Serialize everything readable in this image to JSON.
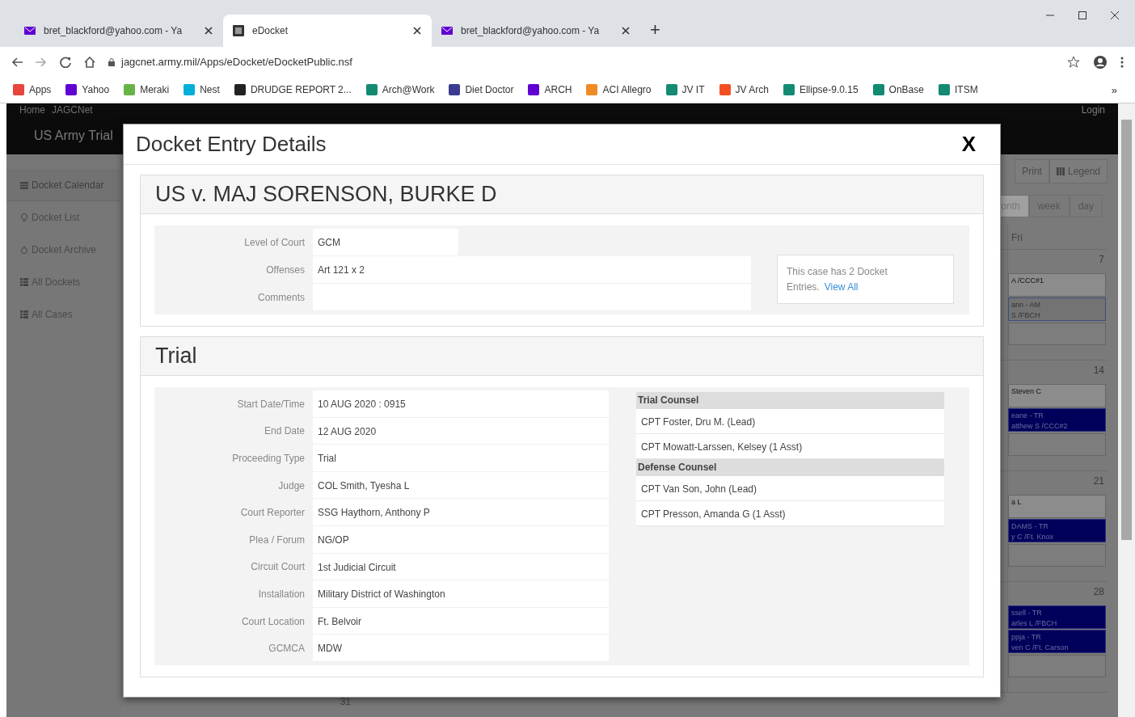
{
  "browser": {
    "tabs": [
      {
        "title": "bret_blackford@yahoo.com - Ya",
        "kind": "mail",
        "selected": false
      },
      {
        "title": "eDocket",
        "kind": "doc",
        "selected": true
      },
      {
        "title": "bret_blackford@yahoo.com - Ya",
        "kind": "mail",
        "selected": false
      }
    ],
    "new_tab": "+",
    "address": "jagcnet.army.mil/Apps/eDocket/eDocketPublic.nsf",
    "bookmarks": [
      {
        "label": "Apps",
        "color": "#e8453c"
      },
      {
        "label": "Yahoo",
        "color": "#6001d2"
      },
      {
        "label": "Meraki",
        "color": "#67b346"
      },
      {
        "label": "Nest",
        "color": "#00afd8"
      },
      {
        "label": "DRUDGE REPORT 2...",
        "color": "#222222"
      },
      {
        "label": "Arch@Work",
        "color": "#138a72"
      },
      {
        "label": "Diet Doctor",
        "color": "#3b3b8f"
      },
      {
        "label": "ARCH",
        "color": "#6001d2"
      },
      {
        "label": "ACI Allegro",
        "color": "#f08a24"
      },
      {
        "label": "JV IT",
        "color": "#138a72"
      },
      {
        "label": "JV Arch",
        "color": "#f25022"
      },
      {
        "label": "Ellipse-9.0.15",
        "color": "#138a72"
      },
      {
        "label": "OnBase",
        "color": "#138a72"
      },
      {
        "label": "ITSM",
        "color": "#138a72"
      }
    ],
    "more": "»"
  },
  "page": {
    "nav_links": [
      "Home",
      "JAGCNet"
    ],
    "login": "Login",
    "site_title": "US Army Trial",
    "sidebar": [
      {
        "label": "Docket Calendar",
        "kind": "calendar",
        "selected": true
      },
      {
        "label": "Docket List",
        "kind": "bulb",
        "selected": false
      },
      {
        "label": "Docket Archive",
        "kind": "archive",
        "selected": false
      },
      {
        "label": "All Dockets",
        "kind": "grid",
        "selected": false
      },
      {
        "label": "All Cases",
        "kind": "grid",
        "selected": false
      }
    ],
    "toolbar": [
      "Print",
      "Legend"
    ],
    "views": [
      {
        "label": "onth",
        "selected": true
      },
      {
        "label": "week",
        "selected": false
      },
      {
        "label": "day",
        "selected": false
      }
    ],
    "weekday": "Fri",
    "weeks": [
      {
        "day": "7",
        "events": [
          {
            "kind": "gray",
            "lines": [
              "A /CCC#1"
            ]
          },
          {
            "kind": "outline",
            "lines": [
              "ann - AM",
              "S /FBCH"
            ]
          }
        ]
      },
      {
        "day": "14",
        "events": [
          {
            "kind": "gray",
            "lines": [
              "Steven C"
            ]
          },
          {
            "kind": "navy",
            "lines": [
              "eane - TR",
              "atthew S /CCC#2"
            ]
          }
        ]
      },
      {
        "day": "21",
        "events": [
          {
            "kind": "gray",
            "lines": [
              "a L"
            ]
          },
          {
            "kind": "navy",
            "lines": [
              "DAMS - TR",
              "y C /Ft. Knox"
            ]
          }
        ]
      },
      {
        "day": "28",
        "events": [
          {
            "kind": "navy",
            "lines": [
              "ssell - TR",
              "arles L /FBCH"
            ]
          },
          {
            "kind": "navy",
            "lines": [
              "ppja - TR",
              "ven C /Ft. Carson"
            ]
          }
        ]
      }
    ],
    "last_row_day": "31"
  },
  "modal": {
    "title": "Docket Entry Details",
    "close": "X",
    "case": {
      "heading": "US v. MAJ SORENSON, BURKE D",
      "fields": [
        {
          "label": "Level of Court",
          "value": "GCM",
          "kind": "short"
        },
        {
          "label": "Offenses",
          "value": "Art 121 x 2",
          "kind": "wide"
        },
        {
          "label": "Comments",
          "kind": "wide"
        }
      ],
      "entries_note": "This case has 2 Docket Entries.",
      "view_all": "View All"
    },
    "trial": {
      "heading": "Trial",
      "fields": [
        {
          "label": "Start Date/Time",
          "value": "10 AUG 2020 : 0915"
        },
        {
          "label": "End Date",
          "value": "12 AUG 2020"
        },
        {
          "label": "Proceeding Type",
          "value": "Trial"
        },
        {
          "label": "Judge",
          "value": "COL Smith, Tyesha L"
        },
        {
          "label": "Court Reporter",
          "value": "SSG Haythorn, Anthony P"
        },
        {
          "label": "Plea / Forum",
          "value": "NG/OP"
        },
        {
          "label": "Circuit Court",
          "value": "1st Judicial Circuit"
        },
        {
          "label": "Installation",
          "value": "Military District of Washington"
        },
        {
          "label": "Court Location",
          "value": "Ft. Belvoir"
        },
        {
          "label": "GCMCA",
          "value": "MDW"
        }
      ],
      "counsel": [
        {
          "heading": "Trial Counsel",
          "members": [
            "CPT Foster, Dru M. (Lead)",
            "CPT Mowatt-Larssen, Kelsey (1 Asst)"
          ]
        },
        {
          "heading": "Defense Counsel",
          "members": [
            "CPT Van Son, John (Lead)",
            "CPT Presson, Amanda G (1 Asst)"
          ]
        }
      ]
    }
  }
}
